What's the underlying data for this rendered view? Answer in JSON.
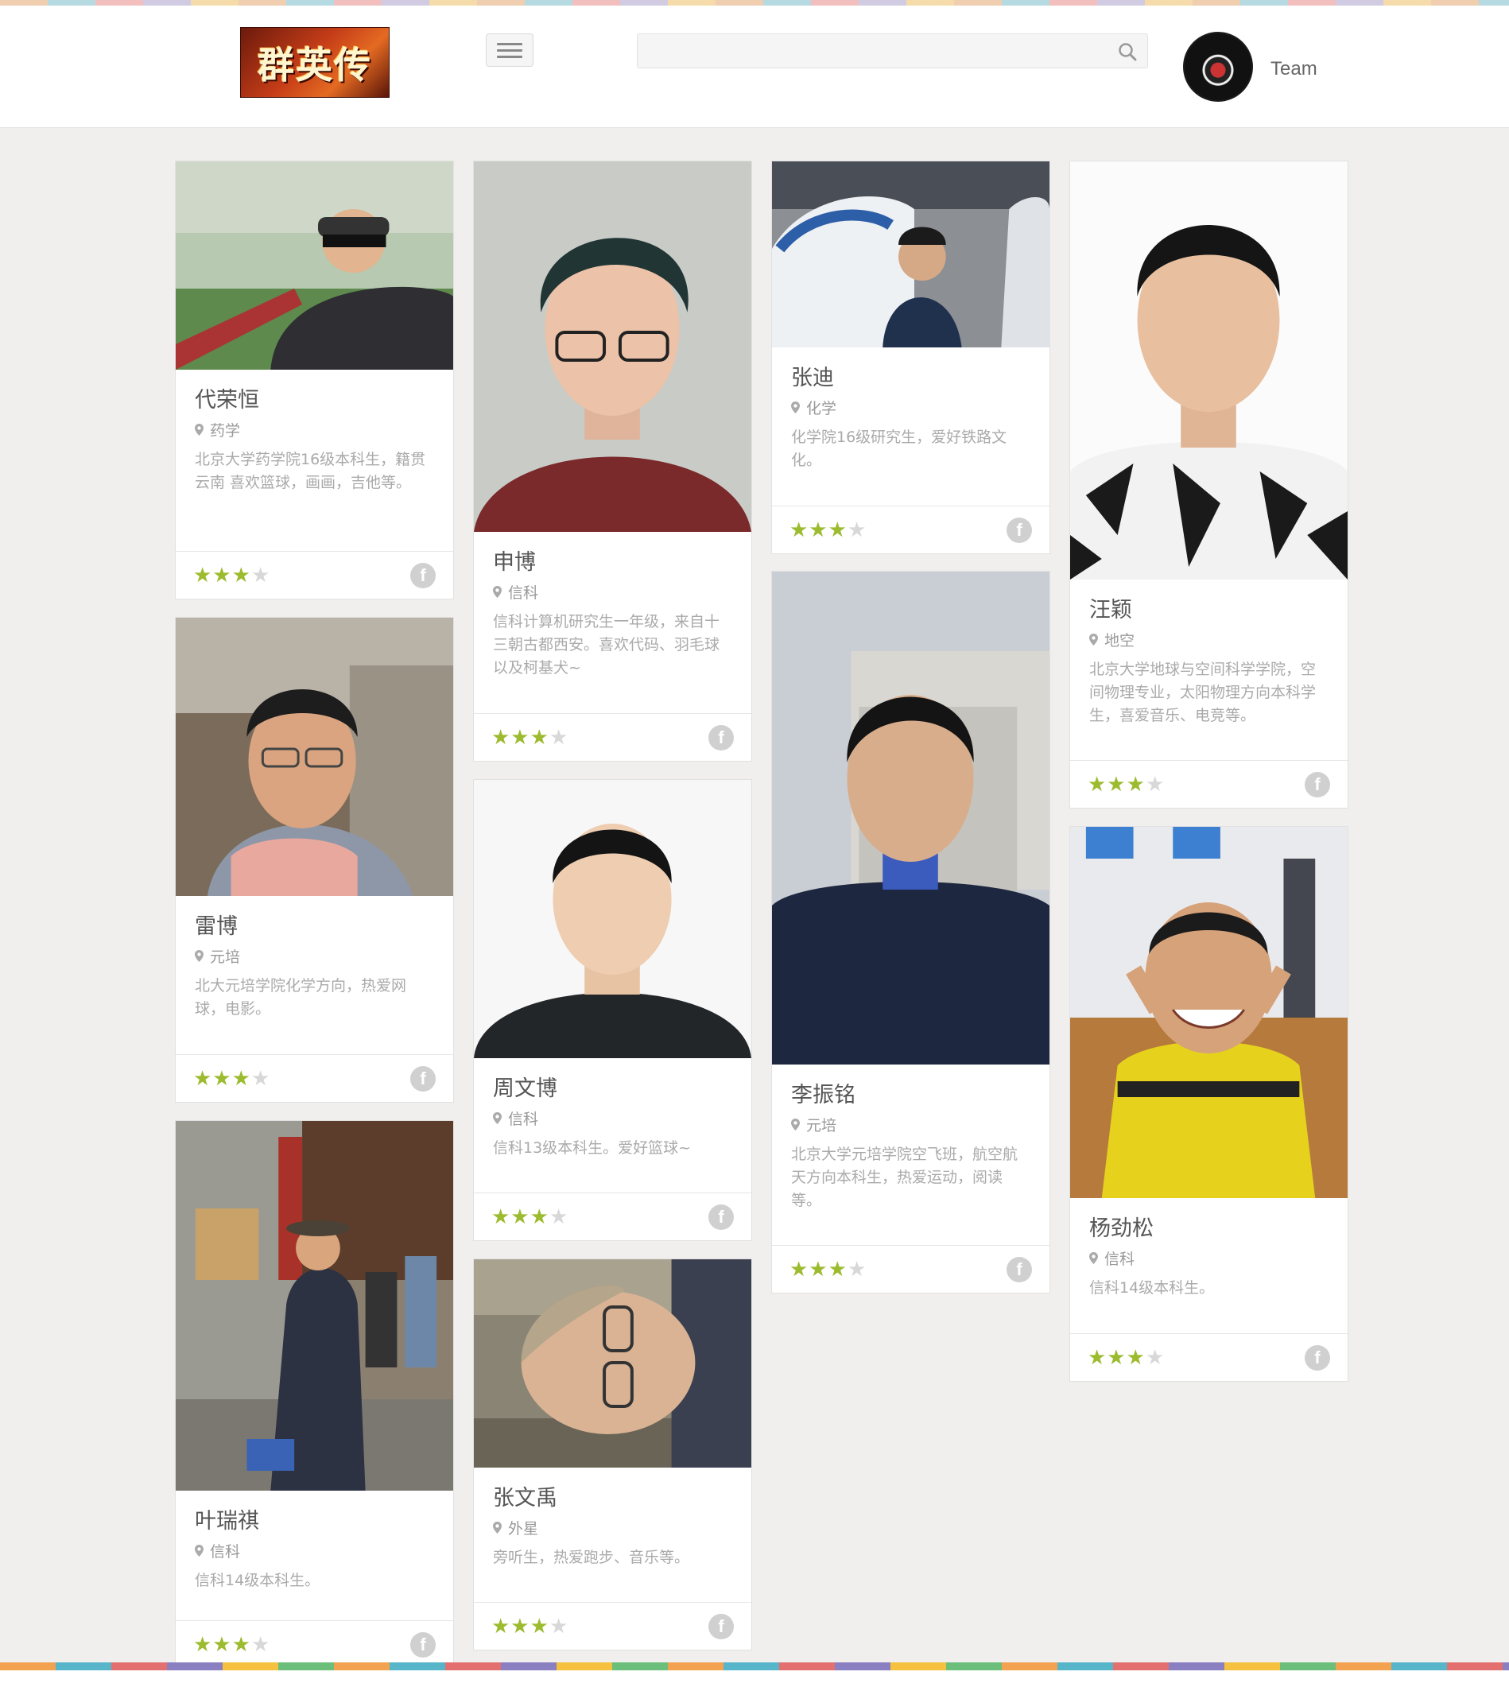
{
  "header": {
    "logo_text": "群英传",
    "search_placeholder": "",
    "team_label": "Team"
  },
  "colors": {
    "star": "#9dbb2f",
    "star_off": "#d8d8d8"
  },
  "icons": {
    "search": "search-icon",
    "menu": "hamburger-menu-icon",
    "location": "map-pin-icon",
    "social": "facebook-icon"
  },
  "cards": [
    {
      "name": "代荣恒",
      "location": "药学",
      "desc": "北京大学药学院16级本科生，籍贯云南 喜欢篮球，画画，吉他等。",
      "rating": 3,
      "max_rating": 4,
      "social": "f"
    },
    {
      "name": "雷博",
      "location": "元培",
      "desc": "北大元培学院化学方向，热爱网球，电影。",
      "rating": 3,
      "max_rating": 4,
      "social": "f"
    },
    {
      "name": "叶瑞祺",
      "location": "信科",
      "desc": "信科14级本科生。",
      "rating": 3,
      "max_rating": 4,
      "social": "f"
    },
    {
      "name": "申博",
      "location": "信科",
      "desc": "信科计算机研究生一年级，来自十三朝古都西安。喜欢代码、羽毛球以及柯基犬~",
      "rating": 3,
      "max_rating": 4,
      "social": "f"
    },
    {
      "name": "周文博",
      "location": "信科",
      "desc": "信科13级本科生。爱好篮球~",
      "rating": 3,
      "max_rating": 4,
      "social": "f"
    },
    {
      "name": "张文禹",
      "location": "外星",
      "desc": "旁听生，热爱跑步、音乐等。",
      "rating": 3,
      "max_rating": 4,
      "social": "f"
    },
    {
      "name": "张迪",
      "location": "化学",
      "desc": "化学院16级研究生，爱好铁路文化。",
      "rating": 3,
      "max_rating": 4,
      "social": "f"
    },
    {
      "name": "李振铭",
      "location": "元培",
      "desc": "北京大学元培学院空飞班，航空航天方向本科生，热爱运动，阅读等。",
      "rating": 3,
      "max_rating": 4,
      "social": "f"
    },
    {
      "name": "汪颖",
      "location": "地空",
      "desc": "北京大学地球与空间科学学院，空间物理专业，太阳物理方向本科学生，喜爱音乐、电竞等。",
      "rating": 3,
      "max_rating": 4,
      "social": "f"
    },
    {
      "name": "杨劲松",
      "location": "信科",
      "desc": "信科14级本科生。",
      "rating": 3,
      "max_rating": 4,
      "social": "f"
    }
  ]
}
